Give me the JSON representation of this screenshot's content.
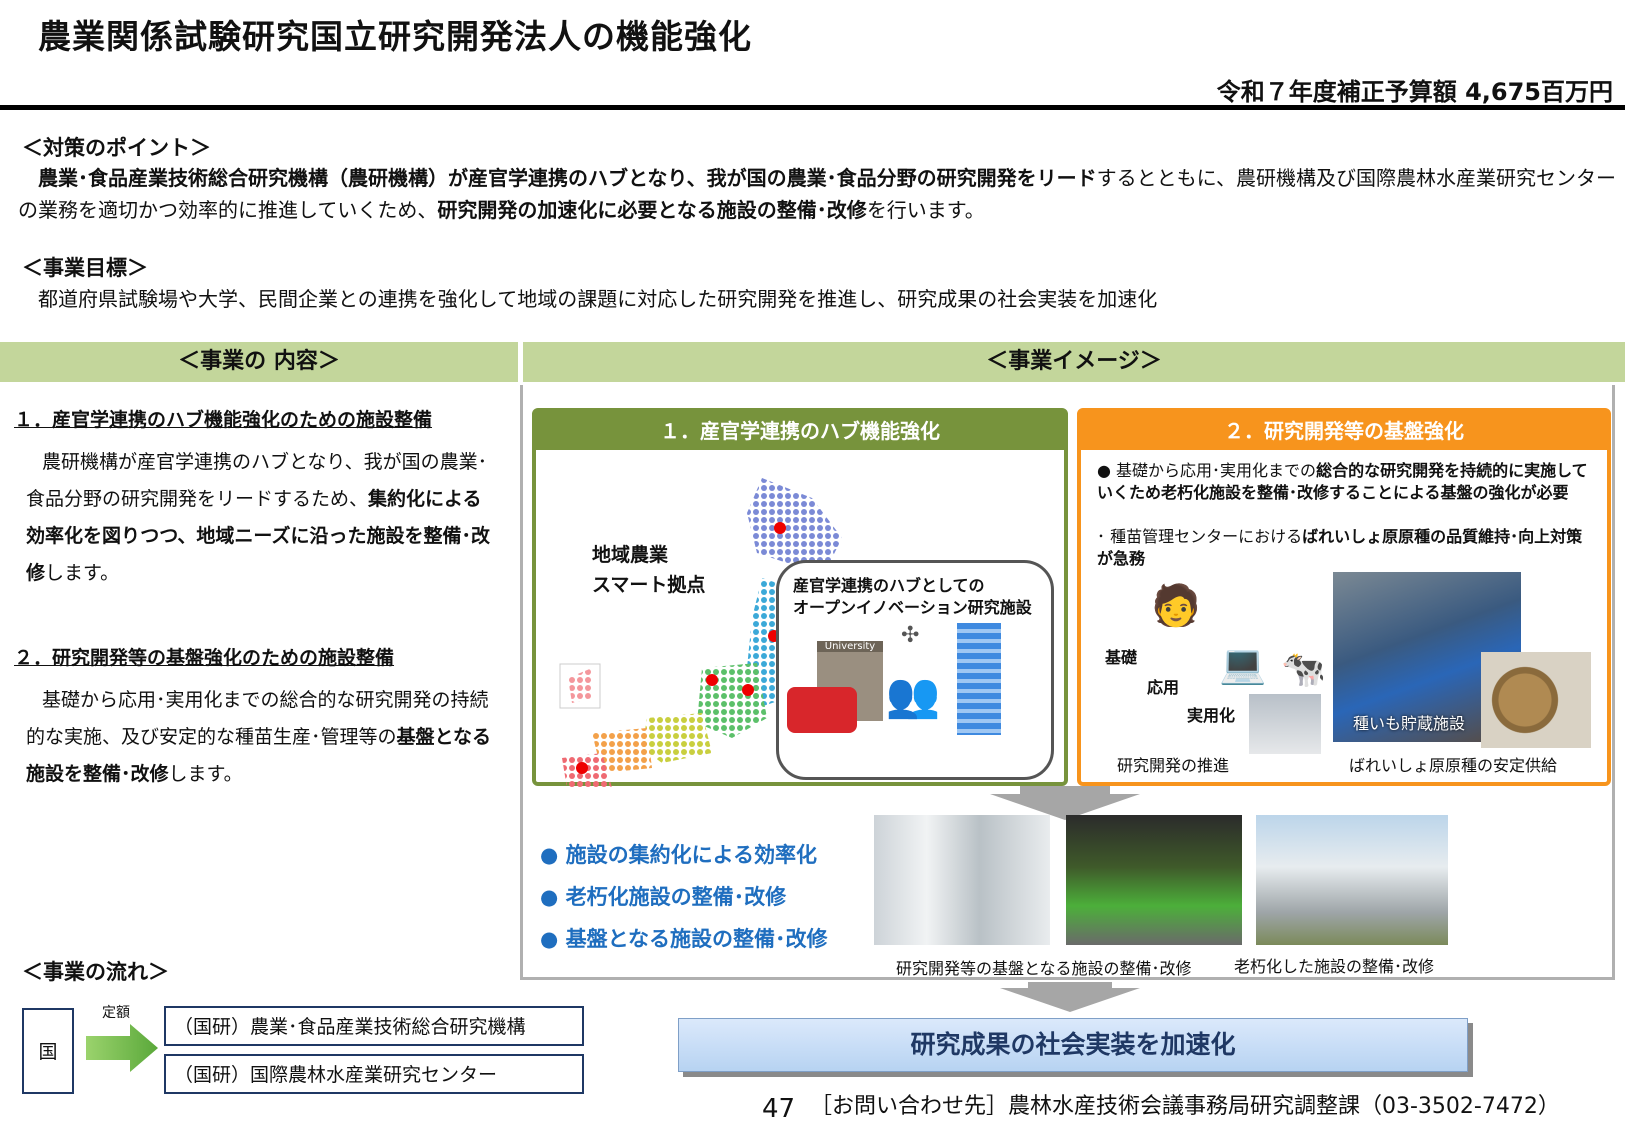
{
  "title": "農業関係試験研究国立研究開発法人の機能強化",
  "budget": "令和７年度補正予算額 4,675百万円",
  "points": {
    "heading": "＜対策のポイント＞",
    "bold1": "農業･食品産業技術総合研究機構（農研機構）が産官学連携のハブとなり、我が国の農業･食品分野の研究開発をリード",
    "plain1": "するとともに、農研機構及び国際農林水産業研究センターの業務を適切かつ効率的に推進していくため、",
    "bold2": "研究開発の加速化に必要となる施設の整備･改修",
    "plain2": "を行います。"
  },
  "goal": {
    "heading": "＜事業目標＞",
    "text": "都道府県試験場や大学、民間企業との連携を強化して地域の課題に対応した研究開発を推進し、研究成果の社会実装を加速化"
  },
  "content_bar": "＜事業の 内容＞",
  "image_bar": "＜事業イメージ＞",
  "left": {
    "h1": "１．産官学連携のハブ機能強化のための施設整備",
    "p1_plain": "農研機構が産官学連携のハブとなり、我が国の農業･食品分野の研究開発をリードするため、",
    "p1_bold": "集約化による効率化を図りつつ、地域ニーズに沿った施設を整備･改修",
    "p1_end": "します。",
    "h2": "２．研究開発等の基盤強化のための施設整備",
    "p2_plain": "基礎から応用･実用化までの総合的な研究開発の持続的な実施、及び安定的な種苗生産･管理等の",
    "p2_bold": "基盤となる施設を整備･改修",
    "p2_end": "します。"
  },
  "panel1": {
    "header": "１．産官学連携のハブ機能強化",
    "map_label": "地域農業\nスマート拠点",
    "bubble_label": "産官学連携のハブとしての\nオープンイノベーション研究施設",
    "university_sign": "University"
  },
  "panel2": {
    "header": "２．研究開発等の基盤強化",
    "bullet1_plain": "基礎から応用･実用化までの",
    "bullet1_bold": "総合的な研究開発を持続的に実施していくため老朽化施設を整備･改修することによる基盤の強化が必要",
    "bullet2_plain": "種苗管理センターにおける",
    "bullet2_bold": "ばれいしょ原原種の品質維持･向上対策が急務",
    "stages": [
      "基礎",
      "応用",
      "実用化"
    ],
    "caption_left": "研究開発の推進",
    "photo_label": "種いも貯蔵施設",
    "caption_right": "ばれいしょ原原種の安定供給"
  },
  "bullets": [
    "施設の集約化による効率化",
    "老朽化施設の整備･改修",
    "基盤となる施設の整備･改修"
  ],
  "photo_captions": [
    "研究開発等の基盤となる施設の整備･改修",
    "老朽化した施設の整備･改修"
  ],
  "flow": {
    "heading": "＜事業の流れ＞",
    "source": "国",
    "arrow_label": "定額",
    "recipients": [
      "（国研）農業･食品産業技術総合研究機構",
      "（国研）国際農林水産業研究センター"
    ]
  },
  "result": "研究成果の社会実装を加速化",
  "page_number": "47",
  "contact": "［お問い合わせ先］農林水産技術会議事務局研究調整課（03-3502-7472）"
}
